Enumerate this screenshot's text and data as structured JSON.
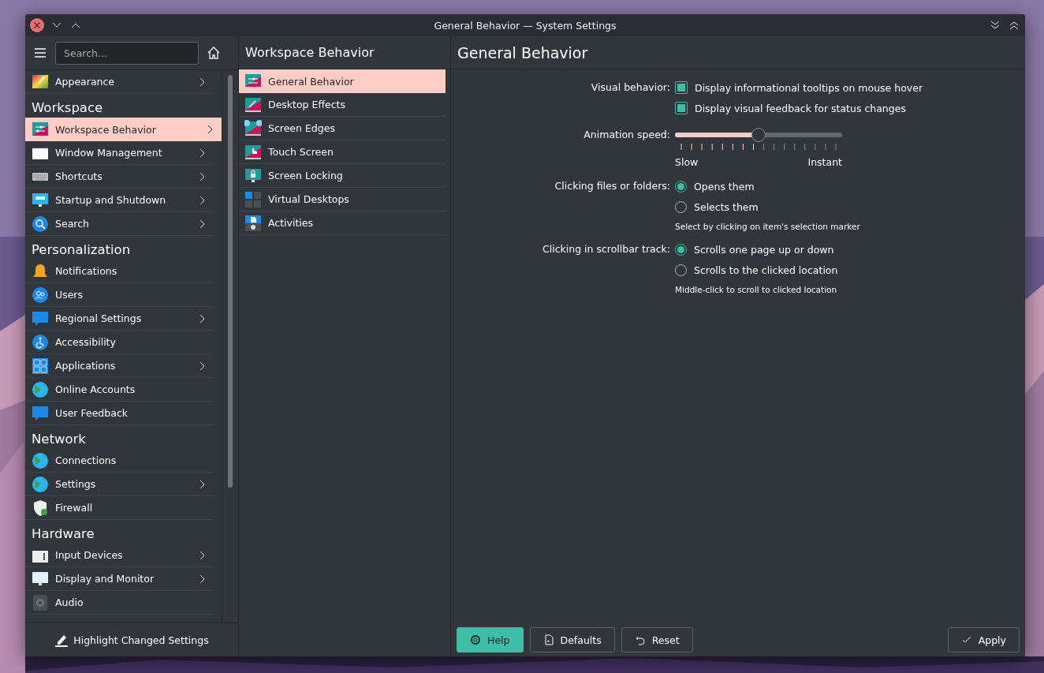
{
  "window": {
    "title": "General Behavior — System Settings"
  },
  "sidebar": {
    "search": {
      "placeholder": "Search..."
    },
    "items": [
      {
        "kind": "item",
        "label": "Appearance",
        "has_children": true,
        "selected": false
      },
      {
        "kind": "category",
        "label": "Workspace"
      },
      {
        "kind": "item",
        "label": "Workspace Behavior",
        "has_children": true,
        "selected": true
      },
      {
        "kind": "item",
        "label": "Window Management",
        "has_children": true,
        "selected": false
      },
      {
        "kind": "item",
        "label": "Shortcuts",
        "has_children": true,
        "selected": false
      },
      {
        "kind": "item",
        "label": "Startup and Shutdown",
        "has_children": true,
        "selected": false
      },
      {
        "kind": "item",
        "label": "Search",
        "has_children": true,
        "selected": false
      },
      {
        "kind": "category",
        "label": "Personalization"
      },
      {
        "kind": "item",
        "label": "Notifications",
        "has_children": false,
        "selected": false
      },
      {
        "kind": "item",
        "label": "Users",
        "has_children": false,
        "selected": false
      },
      {
        "kind": "item",
        "label": "Regional Settings",
        "has_children": true,
        "selected": false
      },
      {
        "kind": "item",
        "label": "Accessibility",
        "has_children": false,
        "selected": false
      },
      {
        "kind": "item",
        "label": "Applications",
        "has_children": true,
        "selected": false
      },
      {
        "kind": "item",
        "label": "Online Accounts",
        "has_children": false,
        "selected": false
      },
      {
        "kind": "item",
        "label": "User Feedback",
        "has_children": false,
        "selected": false
      },
      {
        "kind": "category",
        "label": "Network"
      },
      {
        "kind": "item",
        "label": "Connections",
        "has_children": false,
        "selected": false
      },
      {
        "kind": "item",
        "label": "Settings",
        "has_children": true,
        "selected": false
      },
      {
        "kind": "item",
        "label": "Firewall",
        "has_children": false,
        "selected": false
      },
      {
        "kind": "category",
        "label": "Hardware"
      },
      {
        "kind": "item",
        "label": "Input Devices",
        "has_children": true,
        "selected": false
      },
      {
        "kind": "item",
        "label": "Display and Monitor",
        "has_children": true,
        "selected": false
      },
      {
        "kind": "item",
        "label": "Audio",
        "has_children": false,
        "selected": false
      }
    ],
    "footer_button": "Highlight Changed Settings"
  },
  "subpanel": {
    "title": "Workspace Behavior",
    "items": [
      {
        "label": "General Behavior",
        "selected": true
      },
      {
        "label": "Desktop Effects",
        "selected": false
      },
      {
        "label": "Screen Edges",
        "selected": false
      },
      {
        "label": "Touch Screen",
        "selected": false
      },
      {
        "label": "Screen Locking",
        "selected": false
      },
      {
        "label": "Virtual Desktops",
        "selected": false
      },
      {
        "label": "Activities",
        "selected": false
      }
    ]
  },
  "content": {
    "title": "General Behavior",
    "rows": [
      {
        "kind": "checkboxes",
        "label": "Visual behavior:",
        "options": [
          {
            "label": "Display informational tooltips on mouse hover",
            "checked": true
          },
          {
            "label": "Display visual feedback for status changes",
            "checked": true
          }
        ]
      },
      {
        "kind": "slider",
        "label": "Animation speed:",
        "level": 0.5,
        "min_label": "Slow",
        "max_label": "Instant"
      },
      {
        "kind": "radios",
        "label": "Clicking files or folders:",
        "options": [
          {
            "label": "Opens them",
            "selected": true
          },
          {
            "label": "Selects them",
            "selected": false
          }
        ],
        "hint": "Select by clicking on item's selection marker"
      },
      {
        "kind": "radios",
        "label": "Clicking in scrollbar track:",
        "options": [
          {
            "label": "Scrolls one page up or down",
            "selected": true
          },
          {
            "label": "Scrolls to the clicked location",
            "selected": false
          }
        ],
        "hint": "Middle-click to scroll to clicked location"
      }
    ]
  },
  "left_buttons": [
    {
      "label": "Help",
      "highlighted": true
    },
    {
      "label": "Defaults",
      "highlighted": false
    },
    {
      "label": "Reset",
      "highlighted": false
    }
  ],
  "right_buttons": [
    {
      "label": "Apply",
      "highlighted": false
    }
  ]
}
